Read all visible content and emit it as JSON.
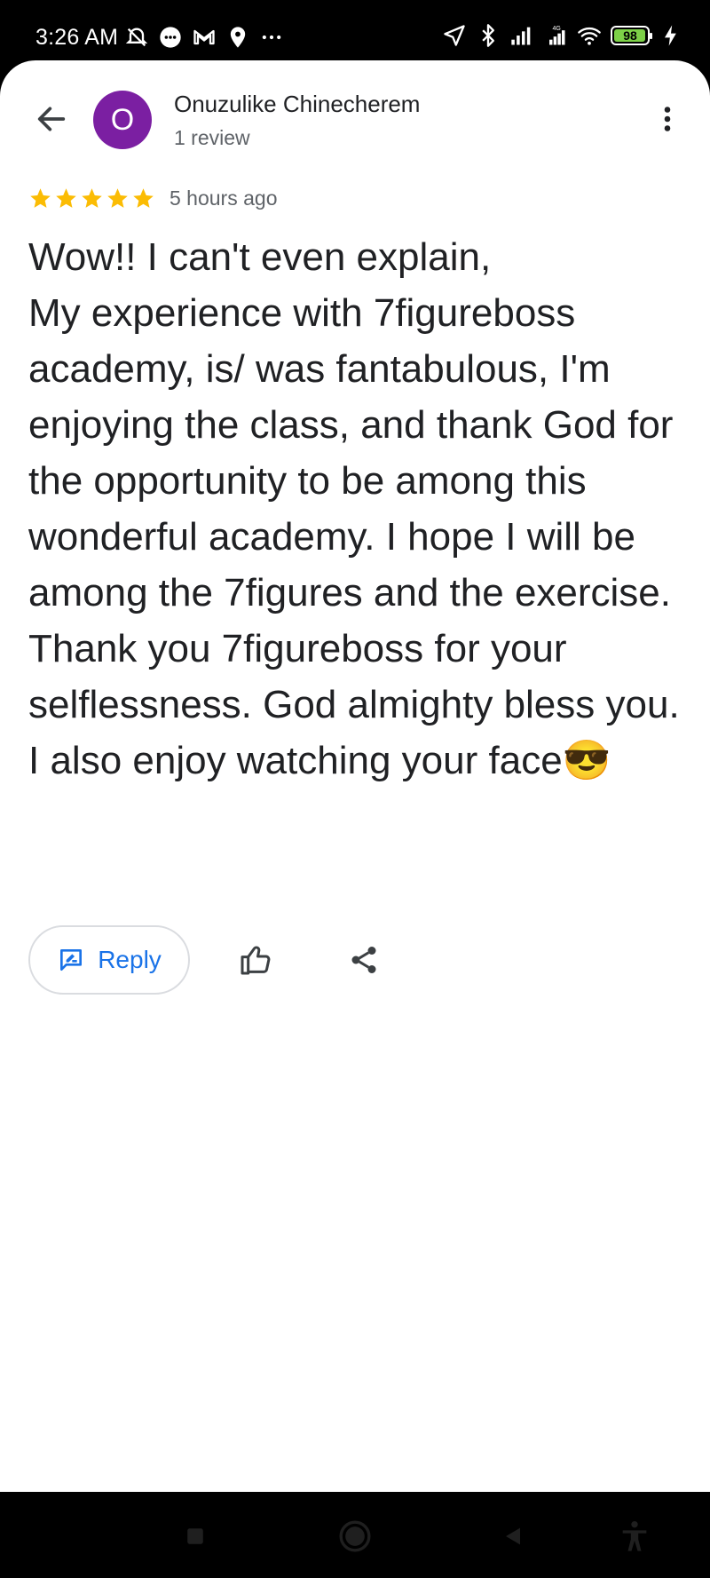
{
  "status_bar": {
    "time": "3:26 AM",
    "battery_level": "98",
    "battery_fraction": 0.98,
    "accent": "#7dd148",
    "left_icons": [
      "alarm-off-icon",
      "chat-bubble-icon",
      "gmail-icon",
      "location-pin-icon",
      "more-dots-icon"
    ],
    "right_icons": [
      "navigation-arrow-icon",
      "bluetooth-icon",
      "signal-icon",
      "signal-4g-icon",
      "wifi-icon",
      "battery-icon",
      "charging-icon"
    ]
  },
  "header": {
    "avatar_letter": "O",
    "avatar_color": "#7b1fa2",
    "reviewer_name": "Onuzulike Chinecherem",
    "review_count": "1 review"
  },
  "review": {
    "rating": 5,
    "rating_max": 5,
    "star_color": "#fbbc04",
    "time_ago": "5 hours ago",
    "text": "Wow!! I can't even explain,\nMy experience with 7figureboss academy,  is/ was fantabulous, I'm enjoying the class, and thank God for the opportunity to be among this wonderful academy. I hope I will be among the 7figures and the exercise. Thank you 7figureboss for your selflessness. God almighty bless you. I also enjoy watching your face😎"
  },
  "actions": {
    "reply_label": "Reply",
    "accent": "#1a73e8"
  },
  "nav_bar": {
    "icons": [
      "recents-square-icon",
      "home-circle-icon",
      "back-triangle-icon",
      "accessibility-icon"
    ]
  }
}
